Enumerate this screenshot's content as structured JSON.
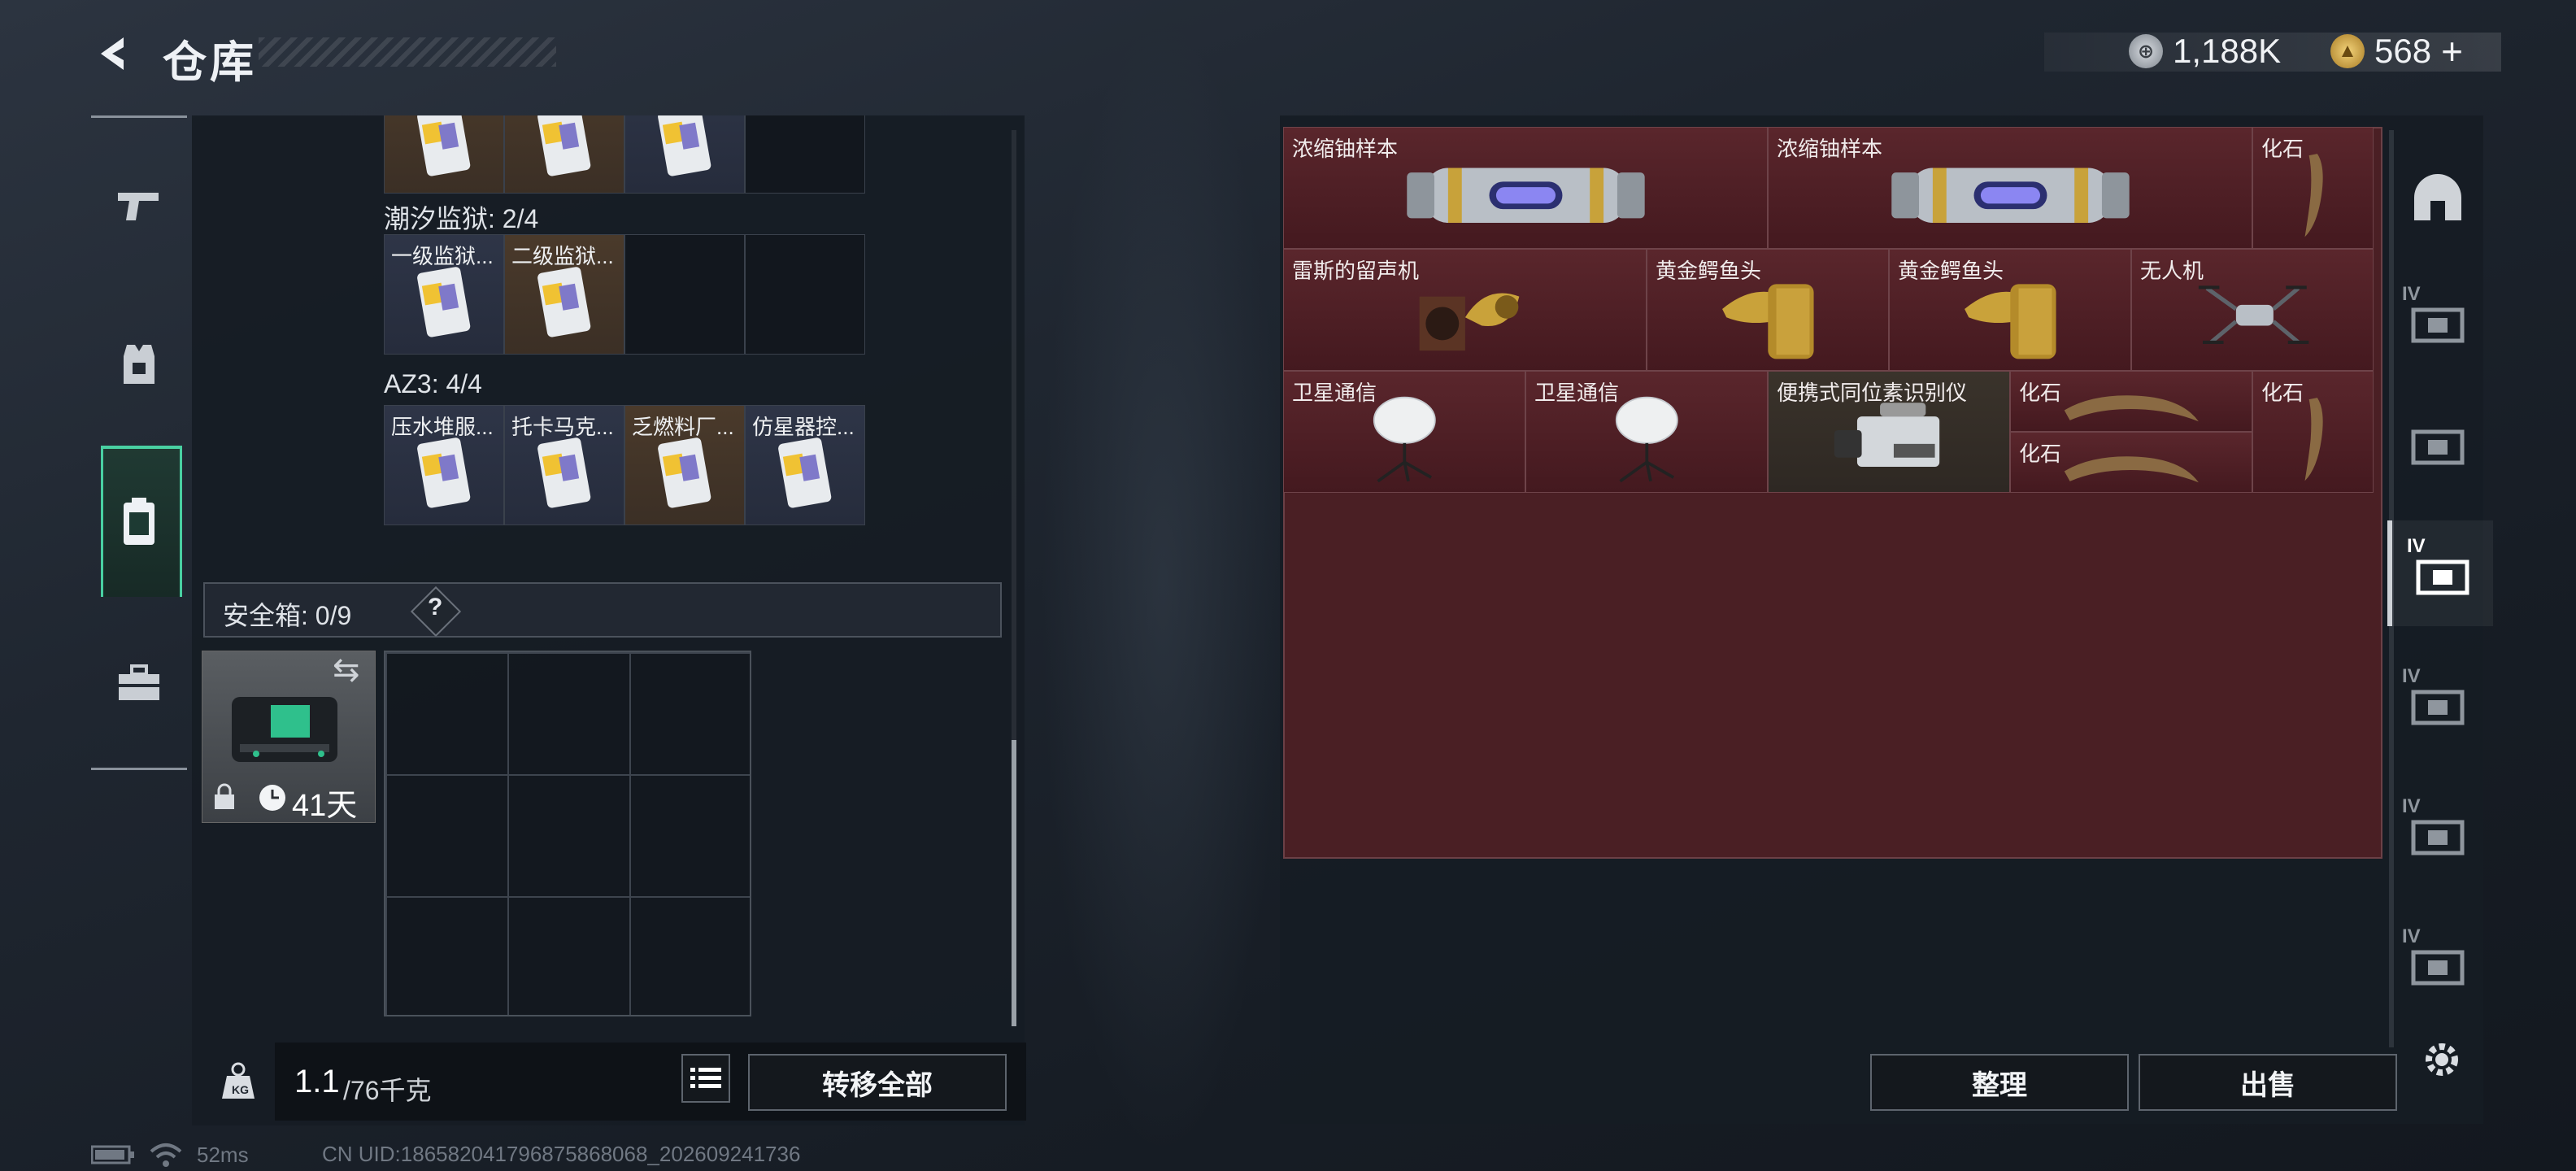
{
  "header": {
    "title": "仓库",
    "currency_silver": "1,188K",
    "currency_gold": "568",
    "currency_gold_plus": "+"
  },
  "left_nav": [
    "weapon-tab",
    "equipment-tab",
    "backpack-tab",
    "case-tab"
  ],
  "left_panel": {
    "top_row": [
      {
        "label": "",
        "bg": "brown"
      },
      {
        "label": "",
        "bg": "brown"
      },
      {
        "label": "",
        "bg": "blue"
      },
      {
        "label": "",
        "bg": "empty"
      }
    ],
    "sections": [
      {
        "title": "潮汐监狱: 2/4",
        "items": [
          {
            "label": "一级监狱...",
            "bg": "blue"
          },
          {
            "label": "二级监狱...",
            "bg": "brown"
          },
          {
            "label": "",
            "bg": "empty"
          },
          {
            "label": "",
            "bg": "empty"
          }
        ]
      },
      {
        "title": "AZ3: 4/4",
        "items": [
          {
            "label": "压水堆服...",
            "bg": "blue"
          },
          {
            "label": "托卡马克...",
            "bg": "blue"
          },
          {
            "label": "乏燃料厂...",
            "bg": "brown"
          },
          {
            "label": "仿星器控...",
            "bg": "blue"
          }
        ]
      }
    ],
    "safebox": {
      "label": "安全箱: 0/9",
      "help": "?",
      "timer": "41天",
      "swap_icon": "⇆"
    },
    "weight": {
      "current": "1.1",
      "max": "/76千克"
    },
    "transfer_all": "转移全部"
  },
  "right_panel": {
    "items": [
      {
        "label": "浓缩铀样本",
        "kind": "canister"
      },
      {
        "label": "浓缩铀样本",
        "kind": "canister"
      },
      {
        "label": "化石",
        "kind": "claw-v"
      },
      {
        "label": "雷斯的留声机",
        "kind": "gramophone"
      },
      {
        "label": "黄金鳄鱼头",
        "kind": "croc"
      },
      {
        "label": "黄金鳄鱼头",
        "kind": "croc"
      },
      {
        "label": "无人机",
        "kind": "drone"
      },
      {
        "label": "卫星通信",
        "kind": "dish"
      },
      {
        "label": "卫星通信",
        "kind": "dish"
      },
      {
        "label": "便携式同位素识别仪",
        "kind": "detector"
      },
      {
        "label": "化石",
        "kind": "claw-h"
      },
      {
        "label": "化石",
        "kind": "claw-h"
      },
      {
        "label": "化石",
        "kind": "claw-v"
      }
    ],
    "sort_button": "整理",
    "sell_button": "出售"
  },
  "right_sidebar": {
    "labels": [
      "",
      "IV",
      "",
      "IV",
      "IV",
      "IV",
      "IV"
    ]
  },
  "status_bar": {
    "ping": "52ms",
    "uid": "CN UID:18658204179687586806​8_202609241736"
  },
  "colors": {
    "accent_green": "#49d0a2",
    "item_red": "#4a1f24",
    "gold": "#c9a23a"
  }
}
